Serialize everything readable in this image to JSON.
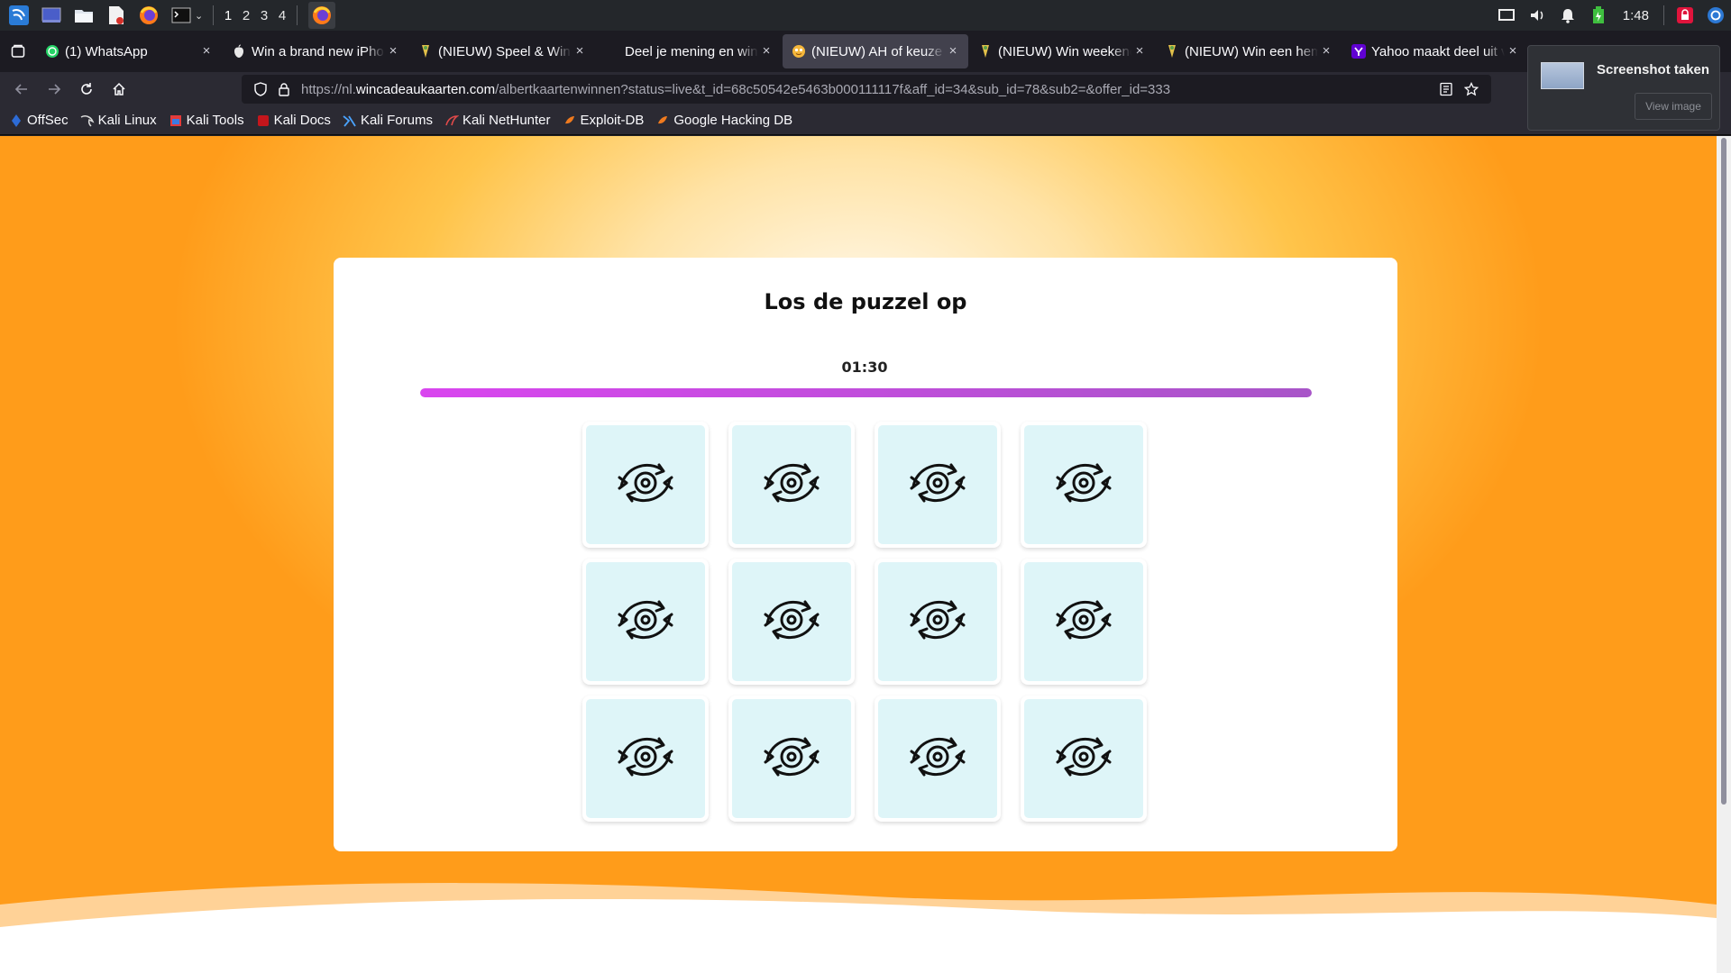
{
  "taskbar": {
    "workspaces": [
      "1",
      "2",
      "3",
      "4"
    ],
    "clock": "1:48"
  },
  "tabs": [
    {
      "label": "(1) WhatsApp",
      "icon": "whatsapp-icon"
    },
    {
      "label": "Win a brand new iPhone",
      "icon": "apple-icon"
    },
    {
      "label": "(NIEUW) Speel & Win Dit",
      "icon": "ah-icon"
    },
    {
      "label": "Deel je mening en win",
      "icon": ""
    },
    {
      "label": "(NIEUW) AH of keuze kaart",
      "icon": "emoji-icon"
    },
    {
      "label": "(NIEUW) Win weekendje",
      "icon": "ah-icon"
    },
    {
      "label": "(NIEUW) Win een hemelbed",
      "icon": "ah-icon"
    },
    {
      "label": "Yahoo maakt deel uit van",
      "icon": "yahoo-icon"
    }
  ],
  "tab_close_glyph": "×",
  "navbar": {
    "url_scheme": "https://nl.",
    "url_host": "wincadeaukaarten.com",
    "url_path": "/albertkaartenwinnen?status=live&t_id=68c50542e5463b000111117f&aff_id=34&sub_id=78&sub2=&offer_id=333"
  },
  "bookmarks": [
    {
      "label": "OffSec"
    },
    {
      "label": "Kali Linux"
    },
    {
      "label": "Kali Tools"
    },
    {
      "label": "Kali Docs"
    },
    {
      "label": "Kali Forums"
    },
    {
      "label": "Kali NetHunter"
    },
    {
      "label": "Exploit-DB"
    },
    {
      "label": "Google Hacking DB"
    }
  ],
  "notification": {
    "title": "Screenshot taken",
    "button": "View image"
  },
  "game": {
    "title": "Los de puzzel op",
    "timer": "01:30",
    "progress": 1.0,
    "tile_count": 12,
    "tile_icon": "flip-eye-icon"
  },
  "colors": {
    "accent": "#d946ef",
    "tile_bg": "#def5f8",
    "page_orange": "#ff9c1a"
  }
}
